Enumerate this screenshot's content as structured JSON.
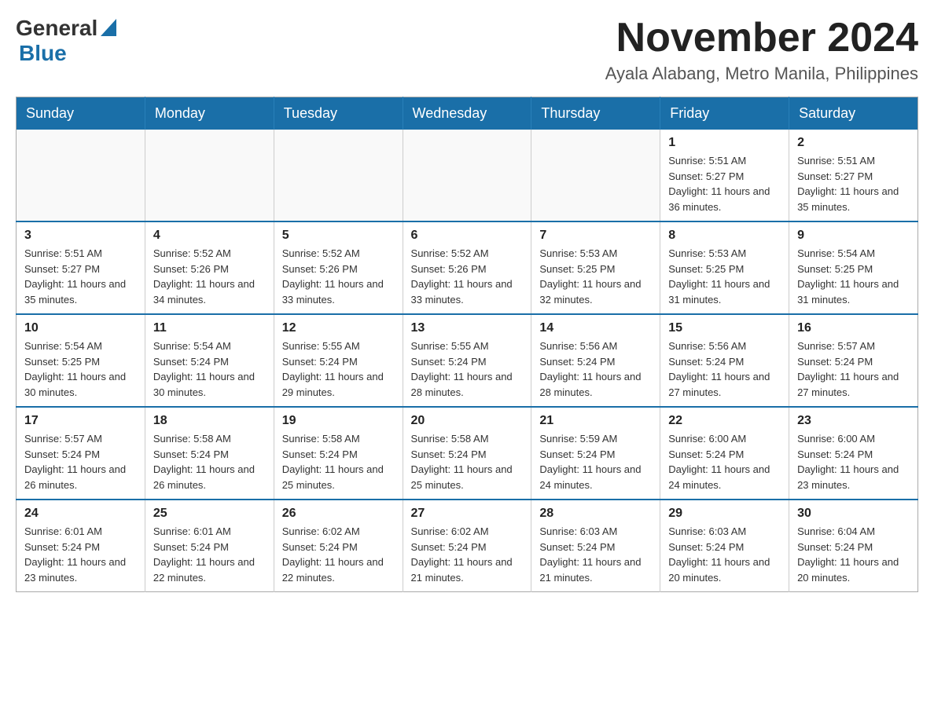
{
  "header": {
    "logo": {
      "general": "General",
      "blue": "Blue"
    },
    "title": "November 2024",
    "location": "Ayala Alabang, Metro Manila, Philippines"
  },
  "calendar": {
    "days": [
      "Sunday",
      "Monday",
      "Tuesday",
      "Wednesday",
      "Thursday",
      "Friday",
      "Saturday"
    ],
    "weeks": [
      [
        {
          "num": "",
          "info": ""
        },
        {
          "num": "",
          "info": ""
        },
        {
          "num": "",
          "info": ""
        },
        {
          "num": "",
          "info": ""
        },
        {
          "num": "",
          "info": ""
        },
        {
          "num": "1",
          "info": "Sunrise: 5:51 AM\nSunset: 5:27 PM\nDaylight: 11 hours and 36 minutes."
        },
        {
          "num": "2",
          "info": "Sunrise: 5:51 AM\nSunset: 5:27 PM\nDaylight: 11 hours and 35 minutes."
        }
      ],
      [
        {
          "num": "3",
          "info": "Sunrise: 5:51 AM\nSunset: 5:27 PM\nDaylight: 11 hours and 35 minutes."
        },
        {
          "num": "4",
          "info": "Sunrise: 5:52 AM\nSunset: 5:26 PM\nDaylight: 11 hours and 34 minutes."
        },
        {
          "num": "5",
          "info": "Sunrise: 5:52 AM\nSunset: 5:26 PM\nDaylight: 11 hours and 33 minutes."
        },
        {
          "num": "6",
          "info": "Sunrise: 5:52 AM\nSunset: 5:26 PM\nDaylight: 11 hours and 33 minutes."
        },
        {
          "num": "7",
          "info": "Sunrise: 5:53 AM\nSunset: 5:25 PM\nDaylight: 11 hours and 32 minutes."
        },
        {
          "num": "8",
          "info": "Sunrise: 5:53 AM\nSunset: 5:25 PM\nDaylight: 11 hours and 31 minutes."
        },
        {
          "num": "9",
          "info": "Sunrise: 5:54 AM\nSunset: 5:25 PM\nDaylight: 11 hours and 31 minutes."
        }
      ],
      [
        {
          "num": "10",
          "info": "Sunrise: 5:54 AM\nSunset: 5:25 PM\nDaylight: 11 hours and 30 minutes."
        },
        {
          "num": "11",
          "info": "Sunrise: 5:54 AM\nSunset: 5:24 PM\nDaylight: 11 hours and 30 minutes."
        },
        {
          "num": "12",
          "info": "Sunrise: 5:55 AM\nSunset: 5:24 PM\nDaylight: 11 hours and 29 minutes."
        },
        {
          "num": "13",
          "info": "Sunrise: 5:55 AM\nSunset: 5:24 PM\nDaylight: 11 hours and 28 minutes."
        },
        {
          "num": "14",
          "info": "Sunrise: 5:56 AM\nSunset: 5:24 PM\nDaylight: 11 hours and 28 minutes."
        },
        {
          "num": "15",
          "info": "Sunrise: 5:56 AM\nSunset: 5:24 PM\nDaylight: 11 hours and 27 minutes."
        },
        {
          "num": "16",
          "info": "Sunrise: 5:57 AM\nSunset: 5:24 PM\nDaylight: 11 hours and 27 minutes."
        }
      ],
      [
        {
          "num": "17",
          "info": "Sunrise: 5:57 AM\nSunset: 5:24 PM\nDaylight: 11 hours and 26 minutes."
        },
        {
          "num": "18",
          "info": "Sunrise: 5:58 AM\nSunset: 5:24 PM\nDaylight: 11 hours and 26 minutes."
        },
        {
          "num": "19",
          "info": "Sunrise: 5:58 AM\nSunset: 5:24 PM\nDaylight: 11 hours and 25 minutes."
        },
        {
          "num": "20",
          "info": "Sunrise: 5:58 AM\nSunset: 5:24 PM\nDaylight: 11 hours and 25 minutes."
        },
        {
          "num": "21",
          "info": "Sunrise: 5:59 AM\nSunset: 5:24 PM\nDaylight: 11 hours and 24 minutes."
        },
        {
          "num": "22",
          "info": "Sunrise: 6:00 AM\nSunset: 5:24 PM\nDaylight: 11 hours and 24 minutes."
        },
        {
          "num": "23",
          "info": "Sunrise: 6:00 AM\nSunset: 5:24 PM\nDaylight: 11 hours and 23 minutes."
        }
      ],
      [
        {
          "num": "24",
          "info": "Sunrise: 6:01 AM\nSunset: 5:24 PM\nDaylight: 11 hours and 23 minutes."
        },
        {
          "num": "25",
          "info": "Sunrise: 6:01 AM\nSunset: 5:24 PM\nDaylight: 11 hours and 22 minutes."
        },
        {
          "num": "26",
          "info": "Sunrise: 6:02 AM\nSunset: 5:24 PM\nDaylight: 11 hours and 22 minutes."
        },
        {
          "num": "27",
          "info": "Sunrise: 6:02 AM\nSunset: 5:24 PM\nDaylight: 11 hours and 21 minutes."
        },
        {
          "num": "28",
          "info": "Sunrise: 6:03 AM\nSunset: 5:24 PM\nDaylight: 11 hours and 21 minutes."
        },
        {
          "num": "29",
          "info": "Sunrise: 6:03 AM\nSunset: 5:24 PM\nDaylight: 11 hours and 20 minutes."
        },
        {
          "num": "30",
          "info": "Sunrise: 6:04 AM\nSunset: 5:24 PM\nDaylight: 11 hours and 20 minutes."
        }
      ]
    ]
  }
}
